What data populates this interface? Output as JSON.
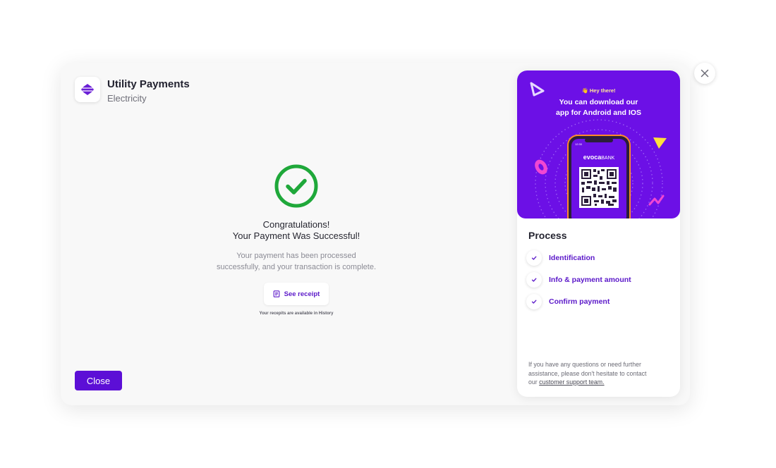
{
  "header": {
    "title": "Utility Payments",
    "subtitle": "Electricity",
    "logo_icon": "electricity-logo-icon"
  },
  "success": {
    "icon": "check-circle-icon",
    "heading_line1": "Congratulations!",
    "heading_line2": "Your Payment Was Successful!",
    "desc_line1": "Your payment has been processed",
    "desc_line2": "successfully, and your transaction is complete.",
    "receipt_label": "See receipt",
    "receipt_icon": "receipt-icon",
    "hint": "Your recepits are available in History"
  },
  "footer": {
    "close_label": "Close"
  },
  "promo": {
    "hey": "👋 Hey there!",
    "msg_line1": "You can download our",
    "msg_line2": "app for Android and IOS",
    "phone_brand_main": "evoca",
    "phone_brand_suffix": "BANK",
    "phone_time": "12:30"
  },
  "process": {
    "title": "Process",
    "steps": [
      {
        "label": "Identification",
        "icon": "check-icon"
      },
      {
        "label": "Info & payment amount",
        "icon": "check-icon"
      },
      {
        "label": "Confirm payment",
        "icon": "check-icon"
      }
    ]
  },
  "support": {
    "text_line1": "If you have any questions or need further",
    "text_line2": "assistance, please don't hesitate to contact",
    "text_prefix": "our ",
    "link": "customer support team."
  },
  "colors": {
    "accent": "#5c0fd6",
    "success": "#1fa83a",
    "promo_bg": "#6c10e6"
  }
}
